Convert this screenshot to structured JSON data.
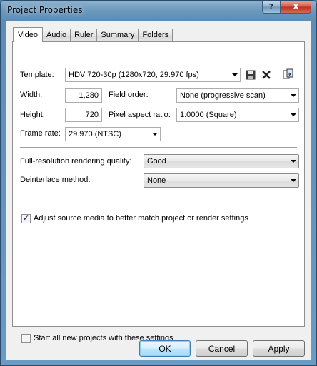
{
  "window": {
    "title": "Project Properties",
    "help_label": "?",
    "close_label": "X"
  },
  "tabs": [
    {
      "label": "Video",
      "active": true
    },
    {
      "label": "Audio"
    },
    {
      "label": "Ruler"
    },
    {
      "label": "Summary"
    },
    {
      "label": "Folders"
    }
  ],
  "video": {
    "template_label": "Template:",
    "template_value": "HDV 720-30p (1280x720, 29.970 fps)",
    "template_icons": [
      "save-icon",
      "delete-icon",
      "match-media-icon"
    ],
    "width_label": "Width:",
    "width_value": "1,280",
    "field_order_label": "Field order:",
    "field_order_value": "None (progressive scan)",
    "height_label": "Height:",
    "height_value": "720",
    "pixel_aspect_label": "Pixel aspect ratio:",
    "pixel_aspect_value": "1.0000 (Square)",
    "frame_rate_label": "Frame rate:",
    "frame_rate_value": "29.970 (NTSC)",
    "render_quality_label": "Full-resolution rendering quality:",
    "render_quality_value": "Good",
    "deinterlace_label": "Deinterlace method:",
    "deinterlace_value": "None",
    "adjust_label": "Adjust source media to better match project or render settings",
    "adjust_checked": true,
    "start_all_label": "Start all new projects with these settings",
    "start_all_checked": false
  },
  "buttons": {
    "ok": "OK",
    "cancel": "Cancel",
    "apply": "Apply"
  },
  "colors": {
    "title_bar": "#6b98bd",
    "default_button": "#3c7fb1"
  }
}
